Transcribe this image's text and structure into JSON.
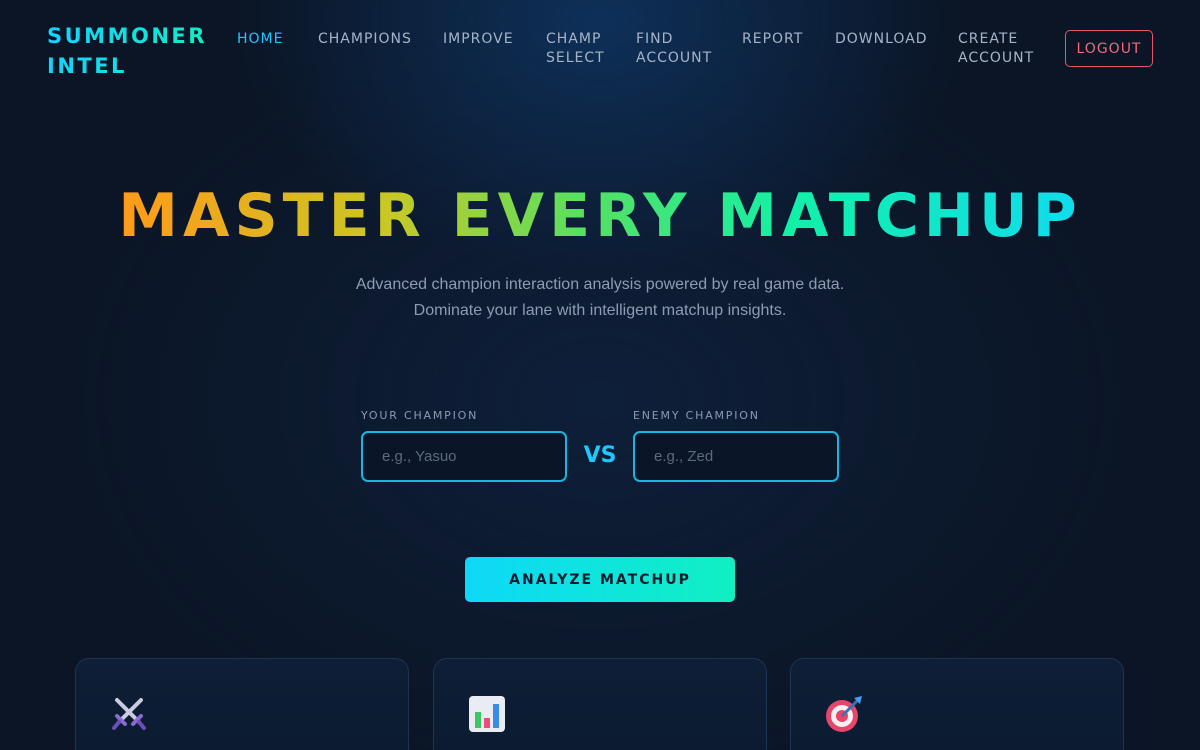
{
  "nav": {
    "logo_line1": "SUMMONER",
    "logo_line2": "INTEL",
    "items": [
      {
        "line1": "HOME",
        "line2": ""
      },
      {
        "line1": "CHAMPIONS",
        "line2": ""
      },
      {
        "line1": "IMPROVE",
        "line2": ""
      },
      {
        "line1": "CHAMP",
        "line2": "SELECT"
      },
      {
        "line1": "FIND",
        "line2": "ACCOUNT"
      },
      {
        "line1": "REPORT",
        "line2": ""
      },
      {
        "line1": "DOWNLOAD",
        "line2": ""
      },
      {
        "line1": "CREATE",
        "line2": "ACCOUNT"
      }
    ],
    "logout_label": "LOGOUT"
  },
  "hero": {
    "title": "MASTER EVERY MATCHUP",
    "subtitle_line1": "Advanced champion interaction analysis powered by real game data.",
    "subtitle_line2": "Dominate your lane with intelligent matchup insights."
  },
  "form": {
    "your_label": "YOUR CHAMPION",
    "your_placeholder": "e.g., Yasuo",
    "your_value": "",
    "vs_label": "VS",
    "enemy_label": "ENEMY CHAMPION",
    "enemy_placeholder": "e.g., Zed",
    "enemy_value": "",
    "analyze_label": "ANALYZE MATCHUP"
  },
  "features": [
    {
      "icon": "crossed-swords-icon"
    },
    {
      "icon": "bar-chart-icon"
    },
    {
      "icon": "target-icon"
    }
  ],
  "colors": {
    "accent_cyan": "#1ec8ff",
    "accent_green": "#10f0c2",
    "logout_red": "#f06a7c",
    "background": "#0b1526"
  }
}
